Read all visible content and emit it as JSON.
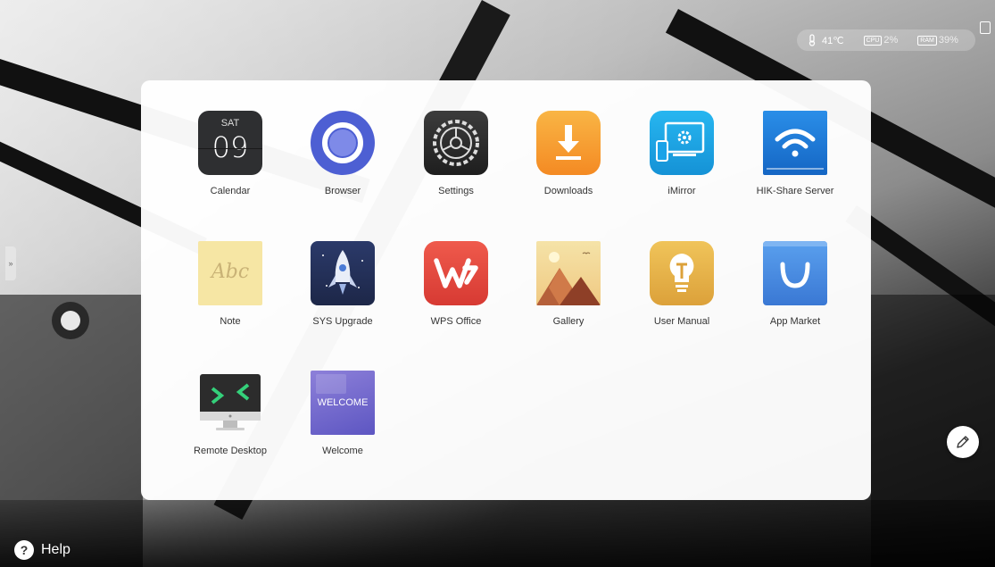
{
  "status": {
    "temperature": "41℃",
    "cpu_chip": "CPU",
    "cpu_value": "2%",
    "mem_chip": "RAM",
    "mem_value": "39%"
  },
  "side_tab": {
    "glyph": "»"
  },
  "help": {
    "label": "Help",
    "glyph": "?"
  },
  "apps": [
    {
      "label": "Calendar",
      "icon": "calendar-icon",
      "day": "SAT",
      "date": "09"
    },
    {
      "label": "Browser",
      "icon": "browser-icon"
    },
    {
      "label": "Settings",
      "icon": "gear-icon"
    },
    {
      "label": "Downloads",
      "icon": "download-icon"
    },
    {
      "label": "iMirror",
      "icon": "screen-mirror-icon"
    },
    {
      "label": "HIK-Share Server",
      "icon": "wifi-share-icon"
    },
    {
      "label": "Note",
      "icon": "note-icon",
      "text": "Abc"
    },
    {
      "label": "SYS Upgrade",
      "icon": "rocket-icon"
    },
    {
      "label": "WPS Office",
      "icon": "wps-icon"
    },
    {
      "label": "Gallery",
      "icon": "gallery-icon"
    },
    {
      "label": "User Manual",
      "icon": "lightbulb-icon"
    },
    {
      "label": "App Market",
      "icon": "shopping-bag-icon"
    },
    {
      "label": "Remote Desktop",
      "icon": "monitor-icon"
    },
    {
      "label": "Welcome",
      "icon": "welcome-icon",
      "text": "WELCOME"
    }
  ],
  "colors": {
    "downloads": "#f7a234",
    "imirror": "#1aa3e8",
    "hikshare": "#1e88e5",
    "wps": "#e2443d",
    "manual": "#e8b84a",
    "market": "#4a90e2",
    "browser": "#5563d6"
  }
}
